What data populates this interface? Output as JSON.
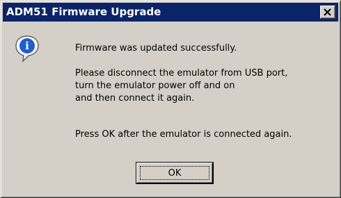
{
  "window": {
    "title": "ADM51 Firmware Upgrade",
    "close_icon": "close-icon"
  },
  "dialog": {
    "icon": "info-icon",
    "message_line1": "Firmware was updated successfully.",
    "message_block2": [
      "Please disconnect the emulator from USB port,",
      "turn the emulator power off and on",
      "and then connect it again."
    ],
    "message_line3": "Press OK after the emulator is connected again.",
    "ok_label": "OK"
  },
  "colors": {
    "titlebar": "#0a246a",
    "face": "#d4d0c8"
  }
}
